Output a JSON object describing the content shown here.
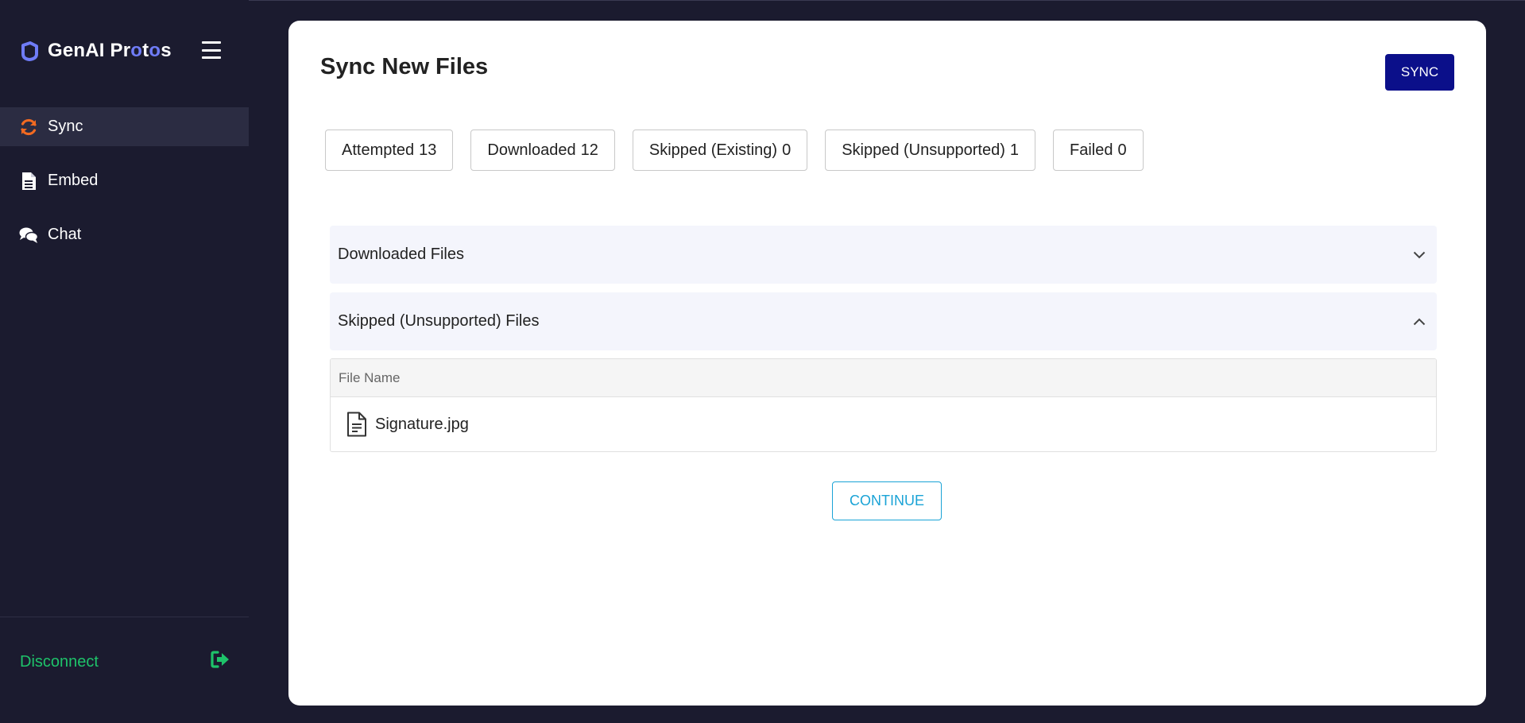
{
  "brand": {
    "name_parts": [
      "GenAI Pr",
      "o",
      "t",
      "o",
      "s"
    ]
  },
  "sidebar": {
    "items": [
      {
        "label": "Sync",
        "icon": "sync-icon",
        "active": true
      },
      {
        "label": "Embed",
        "icon": "document-icon",
        "active": false
      },
      {
        "label": "Chat",
        "icon": "chat-icon",
        "active": false
      }
    ],
    "disconnect_label": "Disconnect",
    "disconnect_icon": "sign-out-icon"
  },
  "main": {
    "title": "Sync New Files",
    "sync_button": "SYNC",
    "stats": [
      {
        "label": "Attempted",
        "value": "13"
      },
      {
        "label": "Downloaded",
        "value": "12"
      },
      {
        "label": "Skipped (Existing)",
        "value": "0"
      },
      {
        "label": "Skipped (Unsupported)",
        "value": "1"
      },
      {
        "label": "Failed",
        "value": "0"
      }
    ],
    "sections": [
      {
        "title": "Downloaded Files",
        "expanded": false
      },
      {
        "title": "Skipped (Unsupported) Files",
        "expanded": true
      }
    ],
    "table": {
      "columns": [
        "File Name"
      ],
      "rows": [
        {
          "file_name": "Signature.jpg",
          "icon": "file-icon"
        }
      ]
    },
    "continue_button": "CONTINUE"
  },
  "colors": {
    "background": "#1b1b2f",
    "sync_accent": "#f26a21",
    "disconnect": "#1ec36a",
    "primary_button": "#0b0f8a",
    "continue_outline": "#1aa3d6"
  }
}
